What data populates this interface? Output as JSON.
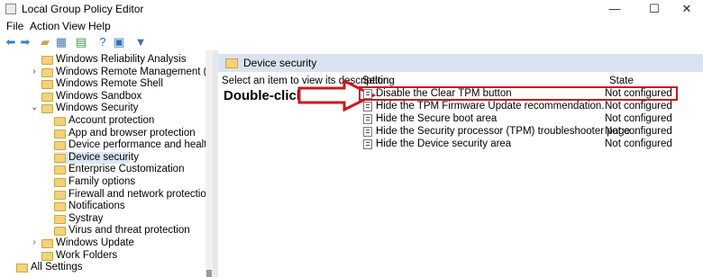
{
  "window": {
    "title": "Local Group Policy Editor",
    "minimize": "—",
    "maximize": "☐",
    "close": "✕"
  },
  "menu": [
    "File",
    "Action",
    "View",
    "Help"
  ],
  "toolbar": [
    "back-icon",
    "forward-icon",
    "up-folder-icon",
    "show-hide-tree-icon",
    "export-icon",
    "help-icon",
    "properties-icon",
    "filter-icon"
  ],
  "tree": {
    "items": [
      {
        "label": "Windows Reliability Analysis",
        "level": 1,
        "expander": ""
      },
      {
        "label": "Windows Remote Management (WinRM)",
        "level": 1,
        "expander": ">"
      },
      {
        "label": "Windows Remote Shell",
        "level": 1,
        "expander": ""
      },
      {
        "label": "Windows Sandbox",
        "level": 1,
        "expander": ""
      },
      {
        "label": "Windows Security",
        "level": 1,
        "expander": "v"
      },
      {
        "label": "Account protection",
        "level": 2,
        "expander": ""
      },
      {
        "label": "App and browser protection",
        "level": 2,
        "expander": ""
      },
      {
        "label": "Device performance and health",
        "level": 2,
        "expander": ""
      },
      {
        "label": "Device security",
        "level": 2,
        "expander": "",
        "selected": true
      },
      {
        "label": "Enterprise Customization",
        "level": 2,
        "expander": ""
      },
      {
        "label": "Family options",
        "level": 2,
        "expander": ""
      },
      {
        "label": "Firewall and network protection",
        "level": 2,
        "expander": ""
      },
      {
        "label": "Notifications",
        "level": 2,
        "expander": ""
      },
      {
        "label": "Systray",
        "level": 2,
        "expander": ""
      },
      {
        "label": "Virus and threat protection",
        "level": 2,
        "expander": ""
      },
      {
        "label": "Windows Update",
        "level": 1,
        "expander": ">"
      },
      {
        "label": "Work Folders",
        "level": 1,
        "expander": ""
      },
      {
        "label": "All Settings",
        "level": 0,
        "expander": ""
      }
    ]
  },
  "details": {
    "header": "Device security",
    "description": "Select an item to view its description.",
    "annotation": "Double-click",
    "columns": {
      "setting": "Setting",
      "state": "State"
    },
    "policies": [
      {
        "name": "Disable the Clear TPM button",
        "state": "Not configured"
      },
      {
        "name": "Hide the TPM Firmware Update recommendation.",
        "state": "Not configured"
      },
      {
        "name": "Hide the Secure boot area",
        "state": "Not configured"
      },
      {
        "name": "Hide the Security processor (TPM) troubleshooter page",
        "state": "Not configured"
      },
      {
        "name": "Hide the Device security area",
        "state": "Not configured"
      }
    ]
  },
  "colors": {
    "highlight": "#c8181f",
    "header_bg": "#d9e3ef",
    "selection": "#d9e8f8"
  }
}
